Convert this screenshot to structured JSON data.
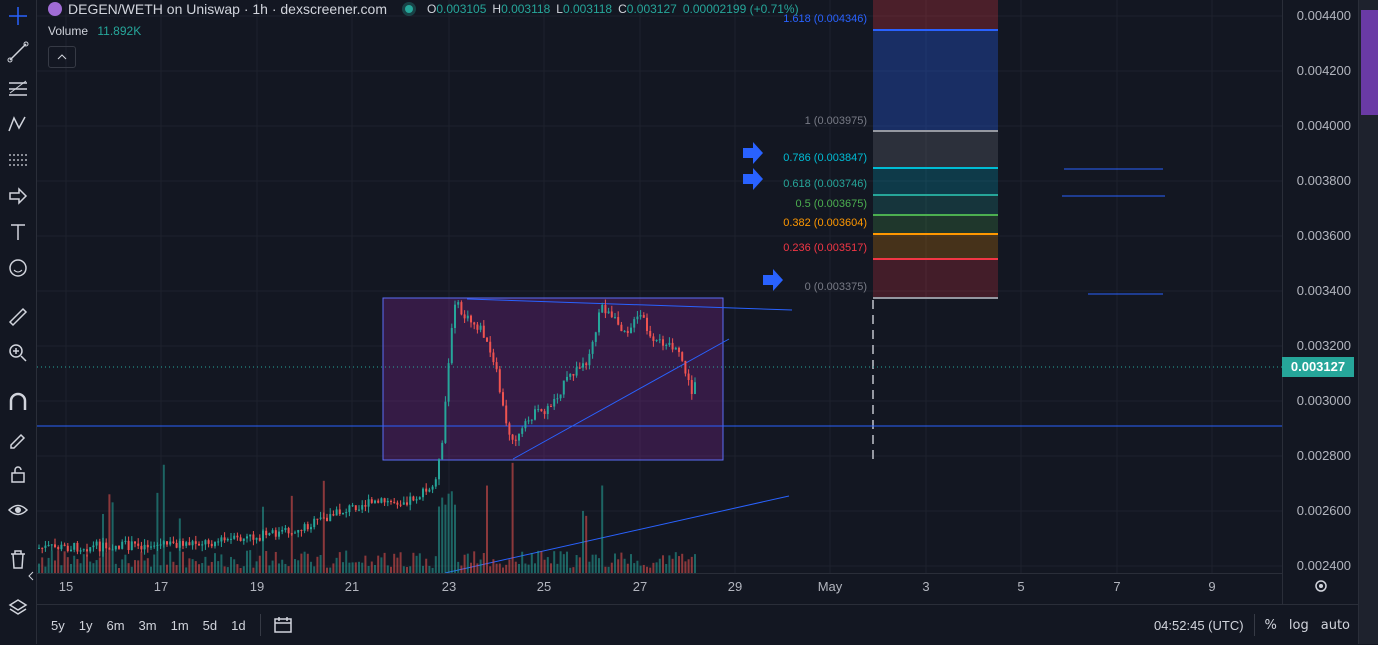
{
  "header": {
    "title": "DEGEN/WETH on Uniswap · 1h · dexscreener.com",
    "o_label": "O",
    "o": "0.003105",
    "h_label": "H",
    "h": "0.003118",
    "l_label": "L",
    "l": "0.003118",
    "c_label": "C",
    "c": "0.003127",
    "change": "0.00002199 (+0.71%)",
    "volume_label": "Volume",
    "volume": "11.892K"
  },
  "price_axis": [
    "0.004400",
    "0.004200",
    "0.004000",
    "0.003800",
    "0.003600",
    "0.003400",
    "0.003200",
    "0.003000",
    "0.002800",
    "0.002600",
    "0.002400"
  ],
  "current_price": "0.003127",
  "time_axis": [
    "15",
    "17",
    "19",
    "21",
    "23",
    "25",
    "27",
    "29",
    "May",
    "3",
    "5",
    "7",
    "9"
  ],
  "fib": [
    {
      "label": "1.618 (0.004346)",
      "color": "#2962ff"
    },
    {
      "label": "1 (0.003975)",
      "color": "#787b86"
    },
    {
      "label": "0.786 (0.003847)",
      "color": "#00bcd4"
    },
    {
      "label": "0.618 (0.003746)",
      "color": "#26a69a"
    },
    {
      "label": "0.5 (0.003675)",
      "color": "#4caf50"
    },
    {
      "label": "0.382 (0.003604)",
      "color": "#ff9800"
    },
    {
      "label": "0.236 (0.003517)",
      "color": "#f23645"
    },
    {
      "label": "0 (0.003375)",
      "color": "#787b86"
    }
  ],
  "ranges": [
    "5y",
    "1y",
    "6m",
    "3m",
    "1m",
    "5d",
    "1d"
  ],
  "bottom_right": {
    "time": "04:52:45 (UTC)",
    "percent": "%",
    "log": "log",
    "auto": "auto"
  },
  "colors": {
    "up": "#26a69a",
    "down": "#ef5350",
    "line": "#2962ff"
  }
}
